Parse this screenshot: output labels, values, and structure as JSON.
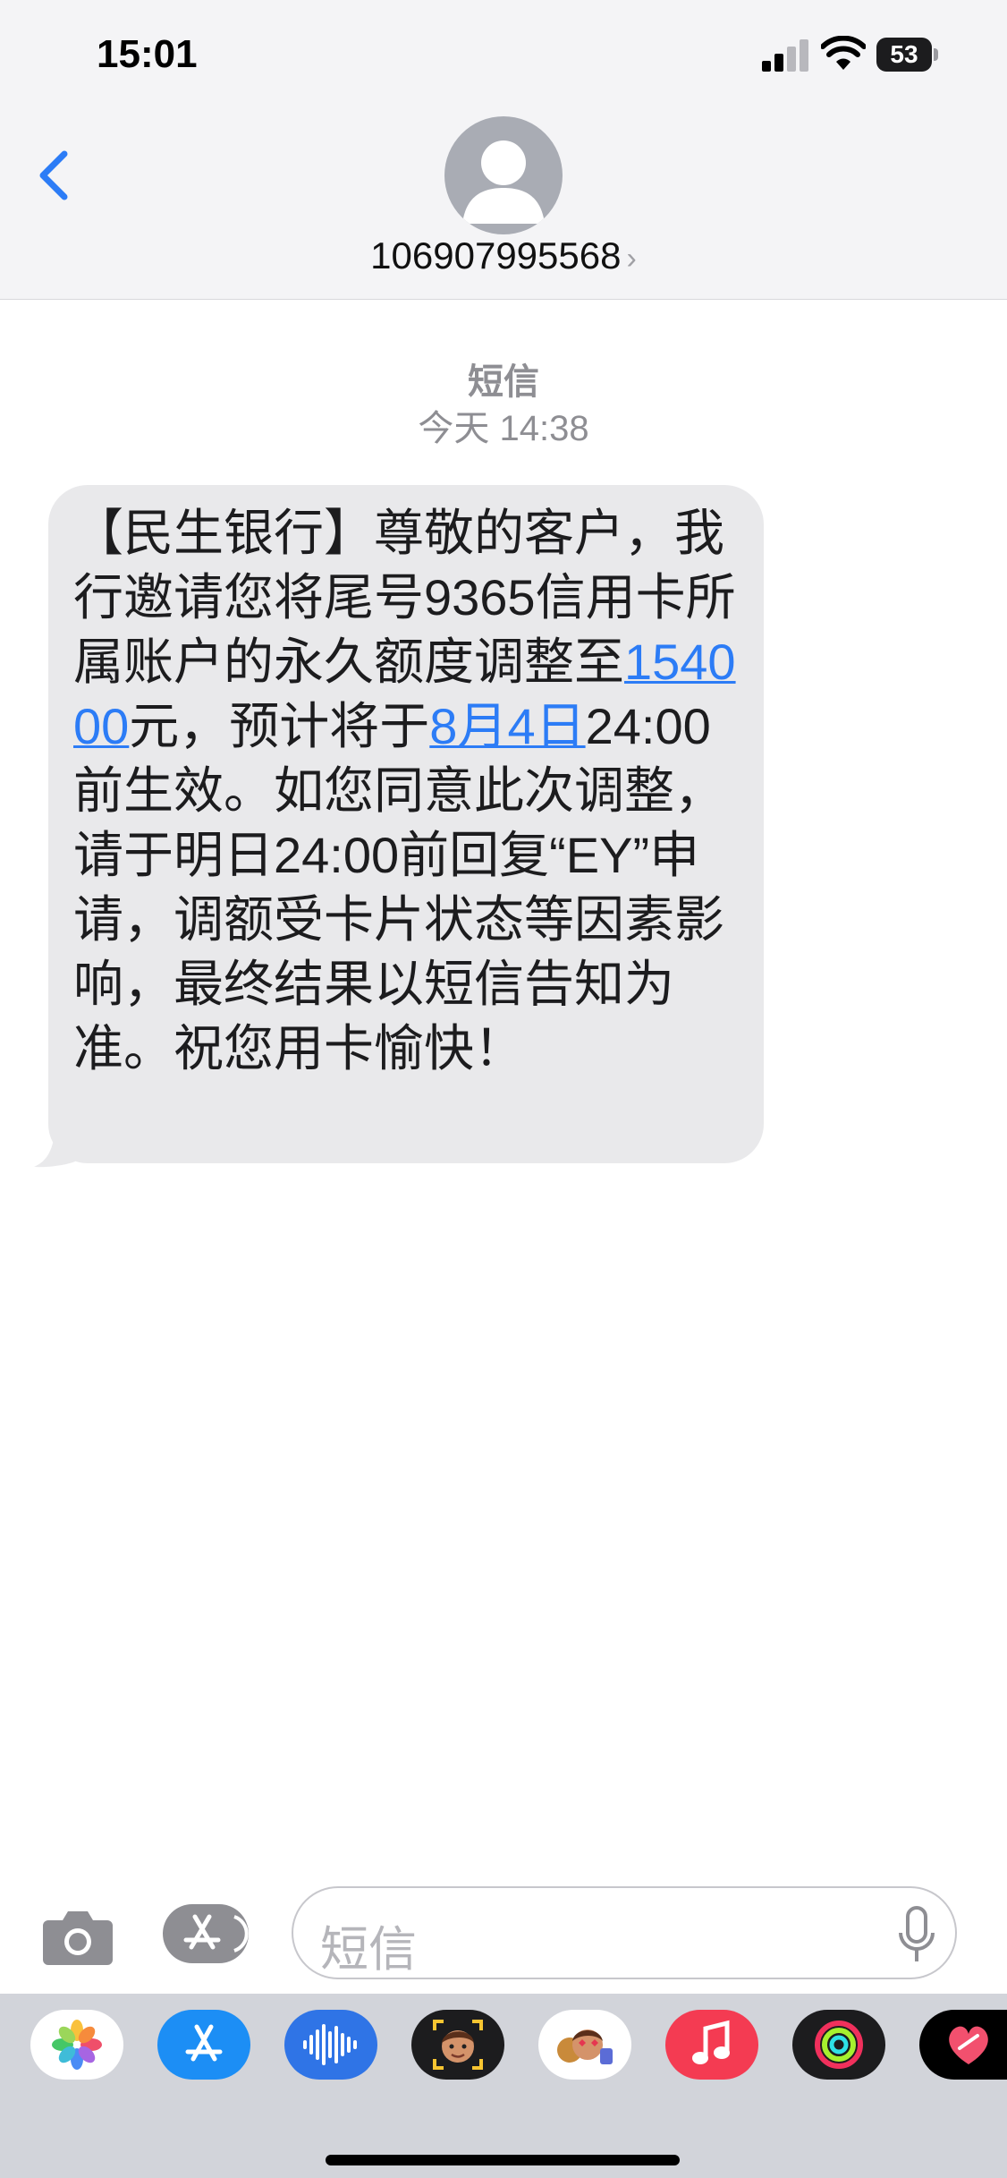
{
  "status_bar": {
    "time": "15:01",
    "battery": "53"
  },
  "header": {
    "contact_number": "106907995568",
    "chevron": "›"
  },
  "conversation": {
    "service_label": "短信",
    "timestamp": "今天 14:38"
  },
  "message": {
    "text_1": "【民生银行】尊敬的客户，我行邀请您将尾号9365信用卡所属账户的永久额度调整至",
    "link_amount": "154000",
    "text_2": "元，预计将于",
    "link_date": "8月4日",
    "text_3": "24:00前生效。如您同意此次调整，请于明日24:00前回复“EY”申请，调额受卡片状态等因素影响，最终结果以短信告知为准。祝您用卡愉快！"
  },
  "composer": {
    "placeholder": "短信"
  },
  "colors": {
    "accent": "#2c7cf6",
    "bubble": "#e9e9eb",
    "header_bg": "#f4f4f6",
    "tray_bg": "#d2d4da"
  },
  "app_tray_icons": [
    "photos-icon",
    "app-store-icon",
    "audio-message-icon",
    "memoji-icon",
    "memoji-stickers-icon",
    "music-icon",
    "activity-icon",
    "digital-touch-icon"
  ]
}
